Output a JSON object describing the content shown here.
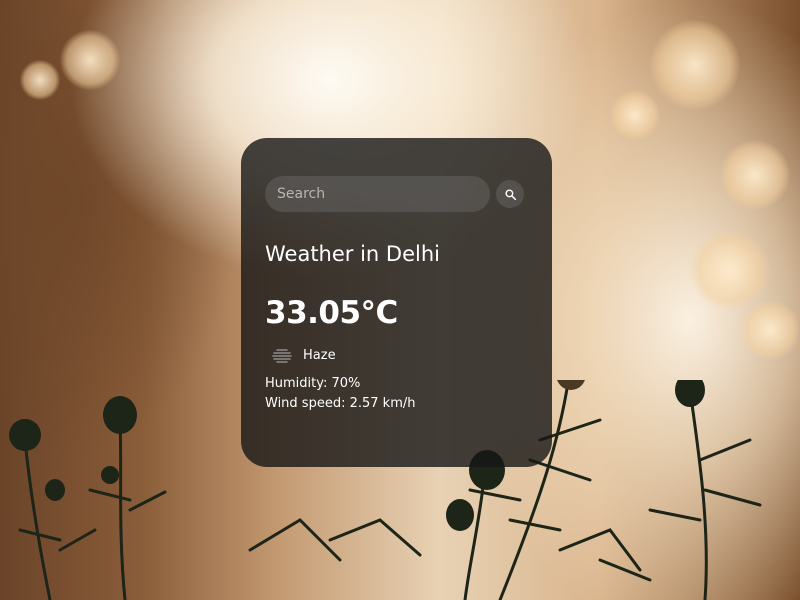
{
  "search": {
    "placeholder": "Search",
    "value": "",
    "button_icon": "search-icon"
  },
  "weather": {
    "city_title": "Weather in Delhi",
    "temperature": "33.05°C",
    "description": "Haze",
    "description_icon": "haze-icon",
    "humidity": "Humidity: 70%",
    "wind_speed": "Wind speed: 2.57 km/h"
  },
  "colors": {
    "card_background": "#161616",
    "text": "#ffffff",
    "input_background": "#787878"
  }
}
